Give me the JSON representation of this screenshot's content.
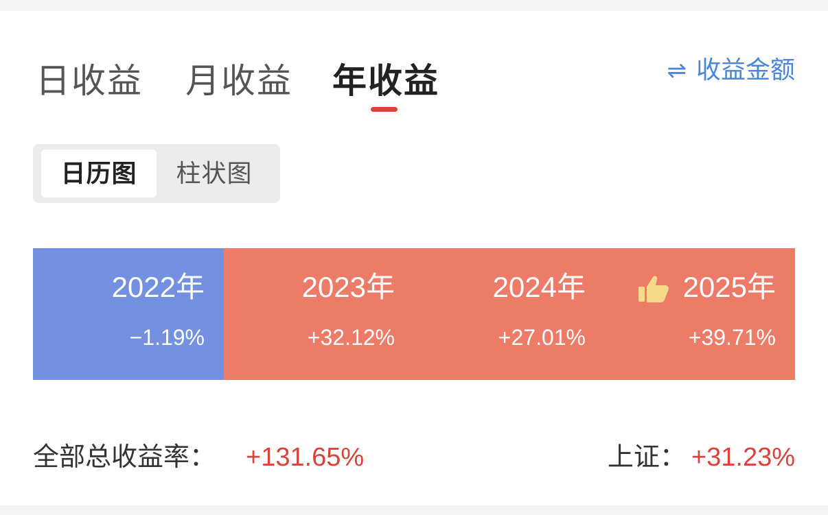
{
  "tabs": [
    {
      "label": "日收益",
      "active": false
    },
    {
      "label": "月收益",
      "active": false
    },
    {
      "label": "年收益",
      "active": true
    }
  ],
  "switch": {
    "icon": "swap-arrows-icon",
    "glyph": "⇌",
    "label": "收益金额"
  },
  "view_toggle": [
    {
      "label": "日历图",
      "active": true
    },
    {
      "label": "柱状图",
      "active": false
    }
  ],
  "years": [
    {
      "year": "2022年",
      "return": "−1.19%",
      "sign": "negative",
      "color": "#7391e0"
    },
    {
      "year": "2023年",
      "return": "+32.12%",
      "sign": "positive",
      "color": "#ec7b68"
    },
    {
      "year": "2024年",
      "return": "+27.01%",
      "sign": "positive",
      "color": "#ec7b68"
    },
    {
      "year": "2025年",
      "return": "+39.71%",
      "sign": "positive",
      "color": "#ec7b68",
      "badge": "thumbs-up-icon"
    }
  ],
  "summary": {
    "total_label": "全部总收益率：",
    "total_value": "+131.65%",
    "index_label": "上证：",
    "index_value": "+31.23%"
  },
  "colors": {
    "accent_red": "#d9433b",
    "link_blue": "#4a86d9",
    "gain": "#ec7b68",
    "loss": "#7391e0"
  }
}
